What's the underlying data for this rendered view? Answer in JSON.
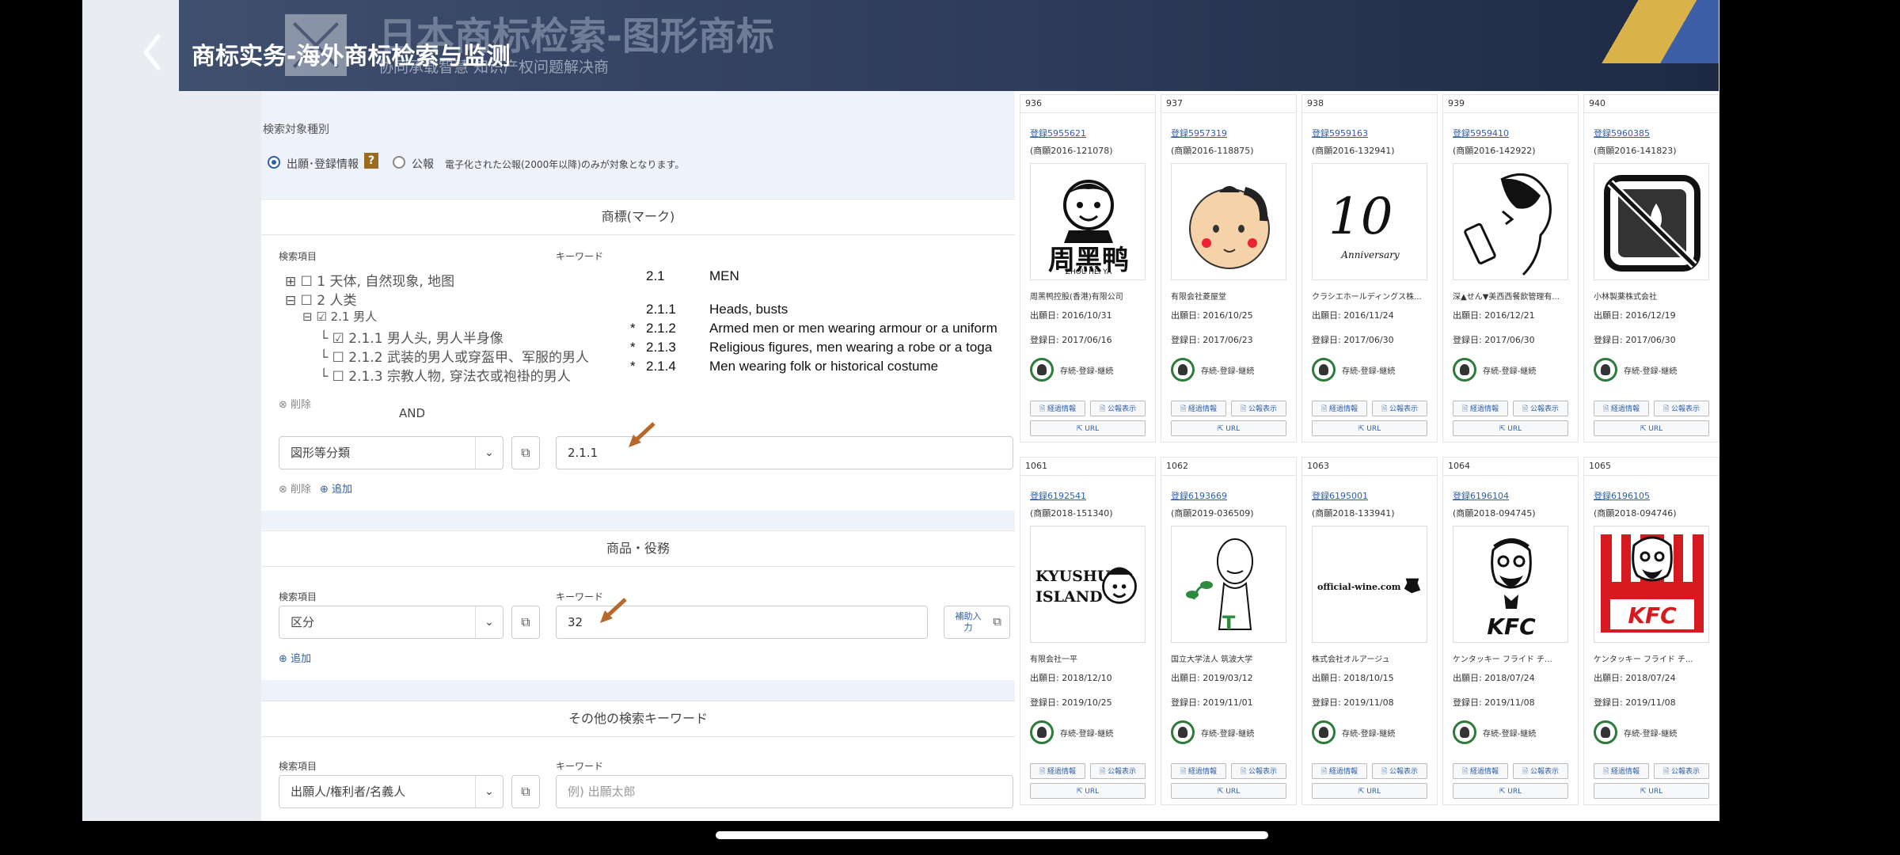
{
  "video": {
    "title": "商标实务-海外商标检索与监测",
    "banner_title": "日本商标检索-图形商标",
    "banner_subtitle": "协同承载智慧  知识产权问题解决商"
  },
  "search": {
    "target_label": "検索対象種別",
    "radio1": "出願･登録情報",
    "help": "?",
    "radio2": "公報",
    "note": "電子化された公報(2000年以降)のみが対象となります。",
    "mark_header": "商標(マーク)",
    "field_label": "検索項目",
    "keyword_label": "キーワード",
    "tree": [
      "1 天体, 自然现象, 地图",
      "2 人类",
      "2.1 男人",
      "2.1.1 男人头, 男人半身像",
      "2.1.2 武装的男人或穿盔甲、军服的男人",
      "2.1.3 宗教人物, 穿法衣或袍褂的男人"
    ],
    "definitions": [
      {
        "code": "2.1",
        "text": "MEN",
        "star": ""
      },
      {
        "code": "2.1.1",
        "text": "Heads, busts",
        "star": ""
      },
      {
        "code": "2.1.2",
        "text": "Armed men or men wearing armour or a uniform",
        "star": "*"
      },
      {
        "code": "2.1.3",
        "text": "Religious figures, men wearing a robe or a toga",
        "star": "*"
      },
      {
        "code": "2.1.4",
        "text": "Men wearing folk or historical costume",
        "star": "*"
      }
    ],
    "delete1": "削除",
    "and_label": "AND",
    "figure_select": "図形等分類",
    "figure_value": "2.1.1",
    "delete2": "削除",
    "add1": "追加",
    "goods_header": "商品・役務",
    "goods_field_label": "検索項目",
    "goods_keyword_label": "キーワード",
    "goods_select": "区分",
    "goods_value": "32",
    "assist_label": "補助入力",
    "add2": "追加",
    "other_header": "その他の検索キーワード",
    "other_field_label": "検索項目",
    "other_keyword_label": "キーワード",
    "other_select": "出願人/権利者/名義人",
    "other_placeholder": "例) 出願太郎"
  },
  "cards": [
    {
      "num": "936",
      "reg": "登録5955621",
      "app": "(商願2016-121078)",
      "owner": "周黑鸭控股(香港)有限公司",
      "d1": "出願日: 2016/10/31",
      "d2": "登録日: 2017/06/16",
      "status": "存続-登録-継続",
      "b1": "経過情報",
      "b2": "公報表示",
      "b3": "URL",
      "logo": "周黑鸭",
      "logo_sub": "ZHOU HEI YA"
    },
    {
      "num": "937",
      "reg": "登録5957319",
      "app": "(商願2016-118875)",
      "owner": "有限会社菱屋堂",
      "d1": "出願日: 2016/10/25",
      "d2": "登録日: 2017/06/23",
      "status": "存続-登録-継続",
      "b1": "経過情報",
      "b2": "公報表示",
      "b3": "URL",
      "logo": "",
      "logo_sub": ""
    },
    {
      "num": "938",
      "reg": "登録5959163",
      "app": "(商願2016-132941)",
      "owner": "クラシエホールディングス株...",
      "d1": "出願日: 2016/11/24",
      "d2": "登録日: 2017/06/30",
      "status": "存続-登録-継続",
      "b1": "経過情報",
      "b2": "公報表示",
      "b3": "URL",
      "logo": "10",
      "logo_sub": "Anniversary"
    },
    {
      "num": "939",
      "reg": "登録5959410",
      "app": "(商願2016-142922)",
      "owner": "深▲せん▼美西西餐飲管理有...",
      "d1": "出願日: 2016/12/21",
      "d2": "登録日: 2017/06/30",
      "status": "存続-登録-継続",
      "b1": "経過情報",
      "b2": "公報表示",
      "b3": "URL",
      "logo": "",
      "logo_sub": ""
    },
    {
      "num": "940",
      "reg": "登録5960385",
      "app": "(商願2016-141823)",
      "owner": "小林製薬株式会社",
      "d1": "出願日: 2016/12/19",
      "d2": "登録日: 2017/06/30",
      "status": "存続-登録-継続",
      "b1": "経過情報",
      "b2": "公報表示",
      "b3": "URL",
      "logo": "",
      "logo_sub": ""
    },
    {
      "num": "1061",
      "reg": "登録6192541",
      "app": "(商願2018-151340)",
      "owner": "有限会社一平",
      "d1": "出願日: 2018/12/10",
      "d2": "登録日: 2019/10/25",
      "status": "存続-登録-継続",
      "b1": "経過情報",
      "b2": "公報表示",
      "b3": "URL",
      "logo": "KYUSHU",
      "logo_sub": "ISLAND"
    },
    {
      "num": "1062",
      "reg": "登録6193669",
      "app": "(商願2019-036509)",
      "owner": "国立大学法人 筑波大学",
      "d1": "出願日: 2019/03/12",
      "d2": "登録日: 2019/11/01",
      "status": "存続-登録-継続",
      "b1": "経過情報",
      "b2": "公報表示",
      "b3": "URL",
      "logo": "T",
      "logo_sub": ""
    },
    {
      "num": "1063",
      "reg": "登録6195001",
      "app": "(商願2018-133941)",
      "owner": "株式会社オルアージュ",
      "d1": "出願日: 2018/10/15",
      "d2": "登録日: 2019/11/08",
      "status": "存続-登録-継続",
      "b1": "経過情報",
      "b2": "公報表示",
      "b3": "URL",
      "logo": "official-wine.com",
      "logo_sub": ""
    },
    {
      "num": "1064",
      "reg": "登録6196104",
      "app": "(商願2018-094745)",
      "owner": "ケンタッキー フライド チ...",
      "d1": "出願日: 2018/07/24",
      "d2": "登録日: 2019/11/08",
      "status": "存続-登録-継続",
      "b1": "経過情報",
      "b2": "公報表示",
      "b3": "URL",
      "logo": "KFC",
      "logo_sub": ""
    },
    {
      "num": "1065",
      "reg": "登録6196105",
      "app": "(商願2018-094746)",
      "owner": "ケンタッキー フライド チ...",
      "d1": "出願日: 2018/07/24",
      "d2": "登録日: 2019/11/08",
      "status": "存続-登録-継続",
      "b1": "経過情報",
      "b2": "公報表示",
      "b3": "URL",
      "logo": "KFC",
      "logo_sub": ""
    }
  ]
}
